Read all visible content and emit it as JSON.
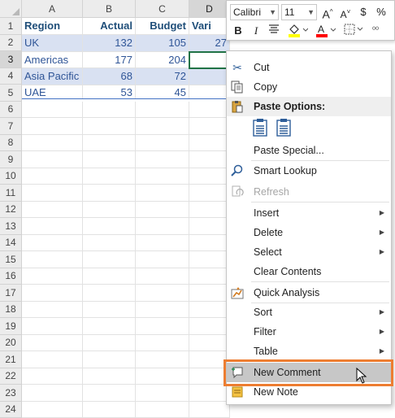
{
  "sheet": {
    "columns": [
      "A",
      "B",
      "C",
      "D"
    ],
    "rows": [
      "1",
      "2",
      "3",
      "4",
      "5",
      "6",
      "7",
      "8",
      "9",
      "10",
      "11",
      "12",
      "13",
      "14",
      "15",
      "16",
      "17",
      "18",
      "19",
      "20",
      "21",
      "22",
      "23",
      "24"
    ],
    "header_row": [
      "Region",
      "Actual",
      "Budget",
      "Vari"
    ],
    "data": [
      [
        "UK",
        "132",
        "105",
        "27"
      ],
      [
        "Americas",
        "177",
        "204",
        ""
      ],
      [
        "Asia Pacific",
        "68",
        "72",
        ""
      ],
      [
        "UAE",
        "53",
        "45",
        ""
      ]
    ]
  },
  "mini_toolbar": {
    "font_name": "Calibri",
    "font_size": "11",
    "grow_font": "A^",
    "shrink_font": "A˅",
    "currency": "$",
    "percent": "%",
    "bold": "B",
    "italic": "I",
    "colors": {
      "fill": "#ffff00",
      "font": "#ff0000"
    }
  },
  "context_menu": {
    "cut": "Cut",
    "copy": "Copy",
    "paste_options": "Paste Options:",
    "paste_special": "Paste Special...",
    "smart_lookup": "Smart Lookup",
    "refresh": "Refresh",
    "insert": "Insert",
    "delete": "Delete",
    "select": "Select",
    "clear_contents": "Clear Contents",
    "quick_analysis": "Quick Analysis",
    "sort": "Sort",
    "filter": "Filter",
    "table": "Table",
    "new_comment": "New Comment",
    "new_note": "New Note"
  },
  "icons": {
    "cut": "scissors-icon",
    "copy": "copy-icon",
    "paste": "clipboard-icon",
    "smart_lookup": "search-icon",
    "refresh": "refresh-icon",
    "quick_analysis": "quick-analysis-icon",
    "new_comment": "new-comment-icon",
    "new_note": "new-note-icon"
  },
  "highlight_color": "#ed7d31"
}
